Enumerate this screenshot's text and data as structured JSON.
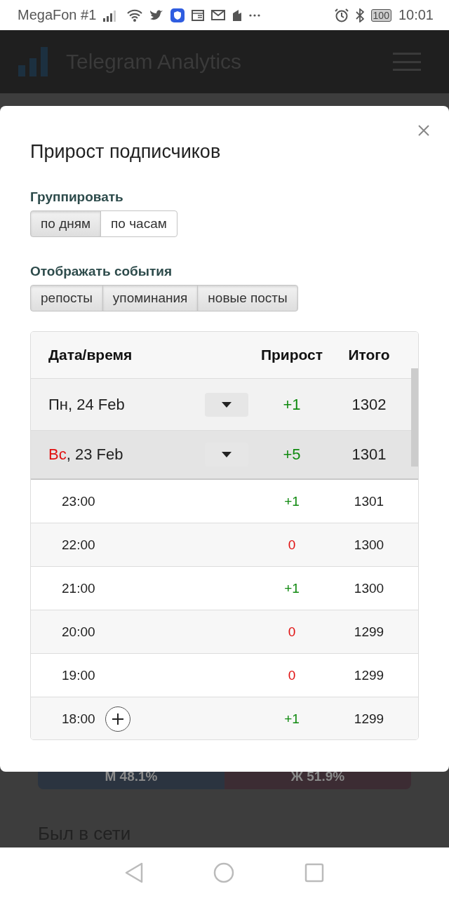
{
  "status_bar": {
    "carrier": "MegaFon #1",
    "battery": "100",
    "time": "10:01"
  },
  "app_bar": {
    "title": "Telegram Analytics"
  },
  "modal": {
    "title": "Прирост подписчиков",
    "groups": [
      {
        "label": "Группировать",
        "options": [
          {
            "label": "по дням",
            "selected": true
          },
          {
            "label": "по часам",
            "selected": false
          }
        ]
      },
      {
        "label": "Отображать события",
        "options": [
          {
            "label": "репосты",
            "selected": true
          },
          {
            "label": "упоминания",
            "selected": true
          },
          {
            "label": "новые посты",
            "selected": true
          }
        ]
      }
    ],
    "table": {
      "columns": [
        "Дата/время",
        "Прирост",
        "Итого"
      ],
      "rows": [
        {
          "day": "Пн",
          "weekend": false,
          "date": ", 24 Feb",
          "expanded": false,
          "delta": "+1",
          "kind": "gain",
          "total": "1302",
          "children": []
        },
        {
          "day": "Вс",
          "weekend": true,
          "date": ", 23 Feb",
          "expanded": true,
          "delta": "+5",
          "kind": "gain",
          "total": "1301",
          "children": [
            {
              "time": "23:00",
              "delta": "+1",
              "kind": "gain",
              "total": "1301",
              "has_event": false
            },
            {
              "time": "22:00",
              "delta": "0",
              "kind": "zero",
              "total": "1300",
              "has_event": false
            },
            {
              "time": "21:00",
              "delta": "+1",
              "kind": "gain",
              "total": "1300",
              "has_event": false
            },
            {
              "time": "20:00",
              "delta": "0",
              "kind": "zero",
              "total": "1299",
              "has_event": false
            },
            {
              "time": "19:00",
              "delta": "0",
              "kind": "zero",
              "total": "1299",
              "has_event": false
            },
            {
              "time": "18:00",
              "delta": "+1",
              "kind": "gain",
              "total": "1299",
              "has_event": true
            }
          ]
        }
      ]
    }
  },
  "background": {
    "gender_bar": [
      {
        "label": "М 48.1%",
        "color": "#2b3440"
      },
      {
        "label": "Ж 51.9%",
        "color": "#3c2c33"
      }
    ],
    "section_title": "Был в сети"
  }
}
